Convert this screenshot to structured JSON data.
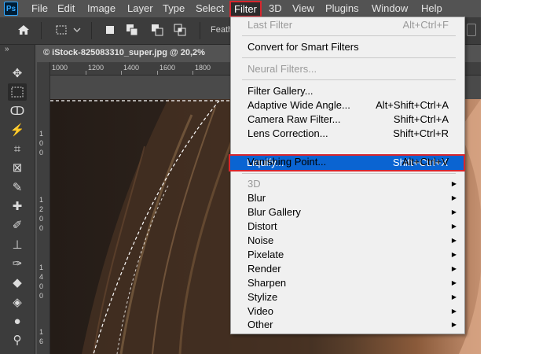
{
  "app": {
    "logo": "Ps",
    "menu": [
      "File",
      "Edit",
      "Image",
      "Layer",
      "Type",
      "Select",
      "Filter",
      "3D",
      "View",
      "Plugins",
      "Window",
      "Help"
    ],
    "active_menu": "Filter"
  },
  "options_bar": {
    "feather_label": "Feath",
    "icons": [
      "home-icon",
      "marquee-preset-icon",
      "chevron-down-icon",
      "new-selection-icon",
      "add-selection-icon",
      "subtract-selection-icon",
      "intersect-selection-icon"
    ]
  },
  "document": {
    "tab_title": "© iStock-825083310_super.jpg @ 20,2%"
  },
  "rulers": {
    "horizontal": [
      "1000",
      "1200",
      "1400",
      "1600",
      "1800"
    ],
    "vertical": [
      "1",
      "0",
      "0",
      "1",
      "2",
      "0",
      "0",
      "1",
      "4",
      "0",
      "0",
      "1",
      "6",
      "0",
      "0"
    ]
  },
  "tools": [
    "move-tool-icon",
    "marquee-tool-icon",
    "lasso-tool-icon",
    "magic-wand-tool-icon",
    "crop-tool-icon",
    "frame-tool-icon",
    "eyedropper-tool-icon",
    "healing-brush-icon",
    "brush-tool-icon",
    "clone-stamp-icon",
    "history-brush-icon",
    "eraser-tool-icon",
    "paint-bucket-icon",
    "blur-tool-icon",
    "dodge-tool-icon"
  ],
  "filter_menu": {
    "last_filter": {
      "label": "Last Filter",
      "shortcut": "Alt+Ctrl+F"
    },
    "smart_filters": "Convert for Smart Filters",
    "neural_filters": "Neural Filters...",
    "items_a": [
      {
        "label": "Filter Gallery...",
        "shortcut": ""
      },
      {
        "label": "Adaptive Wide Angle...",
        "shortcut": "Alt+Shift+Ctrl+A"
      },
      {
        "label": "Camera Raw Filter...",
        "shortcut": "Shift+Ctrl+A"
      },
      {
        "label": "Lens Correction...",
        "shortcut": "Shift+Ctrl+R"
      },
      {
        "label": "Liquify...",
        "shortcut": "Shift+Ctrl+X"
      },
      {
        "label": "Vanishing Point...",
        "shortcut": "Alt+Ctrl+V"
      }
    ],
    "submenus": [
      "3D",
      "Blur",
      "Blur Gallery",
      "Distort",
      "Noise",
      "Pixelate",
      "Render",
      "Sharpen",
      "Stylize",
      "Video",
      "Other"
    ]
  },
  "colors": {
    "menu_highlight": "#0a64d2",
    "annotation_red": "#d7262e"
  }
}
